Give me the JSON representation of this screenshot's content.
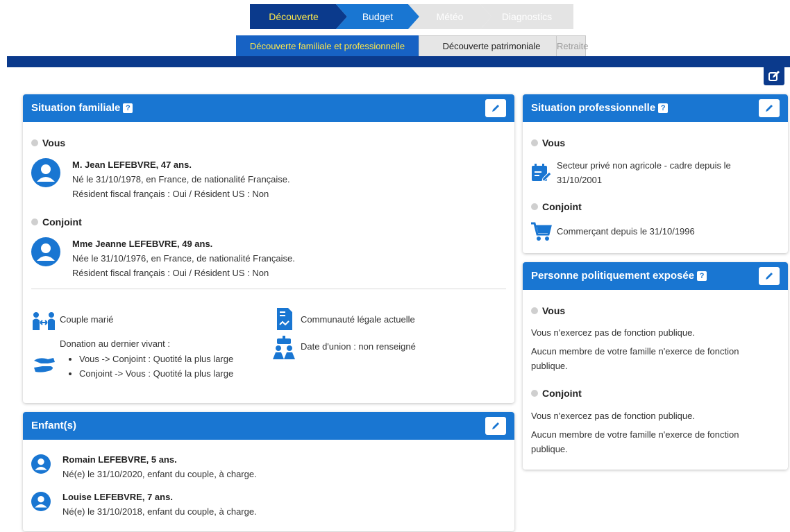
{
  "stepper": {
    "steps": [
      {
        "label": "Découverte"
      },
      {
        "label": "Budget"
      },
      {
        "label": "Météo"
      },
      {
        "label": "Diagnostics"
      }
    ]
  },
  "subtabs": [
    {
      "label": "Découverte familiale et professionnelle"
    },
    {
      "label": "Découverte patrimoniale"
    },
    {
      "label": "Retraite"
    }
  ],
  "colors": {
    "primary": "#1976d2",
    "dark": "#0b3a8c",
    "accent": "#ffe94a"
  },
  "famille": {
    "title": "Situation familiale",
    "help": "?",
    "vous_label": "Vous",
    "vous": {
      "name": "M. Jean LEFEBVRE, 47 ans.",
      "birth": "Né le 31/10/1978, en France, de nationalité Française.",
      "fiscal": "Résident fiscal français : Oui / Résident US : Non"
    },
    "conjoint_label": "Conjoint",
    "conjoint": {
      "name": "Mme Jeanne LEFEBVRE, 49 ans.",
      "birth": "Née le 31/10/1976, en France, de nationalité Française.",
      "fiscal": "Résident fiscal français : Oui / Résident US : Non"
    },
    "couple": "Couple marié",
    "regime": "Communauté légale actuelle",
    "union": "Date d'union : non renseigné",
    "donation_title": "Donation au dernier vivant :",
    "donation_items": [
      "Vous -> Conjoint : Quotité la plus large",
      "Conjoint -> Vous : Quotité la plus large"
    ]
  },
  "enfants": {
    "title": "Enfant(s)",
    "items": [
      {
        "name": "Romain LEFEBVRE, 5 ans.",
        "detail": "Né(e) le 31/10/2020, enfant du couple, à charge."
      },
      {
        "name": "Louise LEFEBVRE, 7 ans.",
        "detail": "Né(e) le 31/10/2018, enfant du couple, à charge."
      }
    ]
  },
  "pro": {
    "title": "Situation professionnelle",
    "help": "?",
    "vous_label": "Vous",
    "vous_line1": "Secteur privé non agricole - cadre depuis le",
    "vous_line2": "31/10/2001",
    "conjoint_label": "Conjoint",
    "conjoint_text": "Commerçant depuis le 31/10/1996"
  },
  "ppe": {
    "title": "Personne politiquement exposée",
    "help": "?",
    "vous_label": "Vous",
    "vous_l1": "Vous n'exercez pas de fonction publique.",
    "vous_l2a": "Aucun membre de votre famille n'exerce de fonction",
    "vous_l2b": "publique.",
    "conjoint_label": "Conjoint",
    "conj_l1": "Vous n'exercez pas de fonction publique.",
    "conj_l2a": "Aucun membre de votre famille n'exerce de fonction",
    "conj_l2b": "publique."
  }
}
